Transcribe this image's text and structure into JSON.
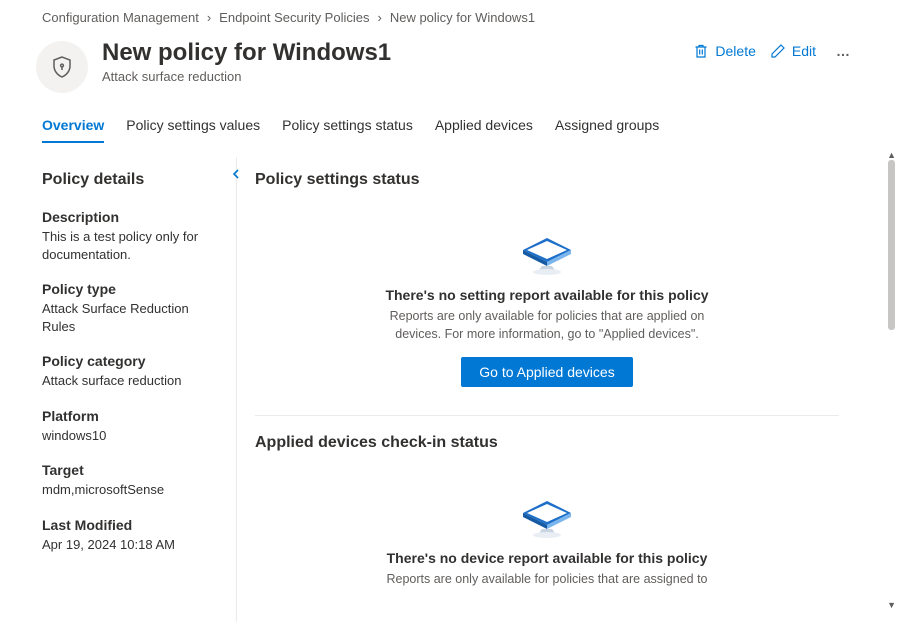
{
  "breadcrumb": {
    "item1": "Configuration Management",
    "item2": "Endpoint Security Policies",
    "item3": "New policy for Windows1"
  },
  "header": {
    "title": "New policy for Windows1",
    "subtitle": "Attack surface reduction",
    "delete_label": "Delete",
    "edit_label": "Edit"
  },
  "tabs": {
    "overview": "Overview",
    "settings_values": "Policy settings values",
    "settings_status": "Policy settings status",
    "applied_devices": "Applied devices",
    "assigned_groups": "Assigned groups"
  },
  "panel": {
    "title": "Policy details",
    "description_label": "Description",
    "description_value": "This is a test policy only for documentation.",
    "type_label": "Policy type",
    "type_value": "Attack Surface Reduction Rules",
    "category_label": "Policy category",
    "category_value": "Attack surface reduction",
    "platform_label": "Platform",
    "platform_value": "windows10",
    "target_label": "Target",
    "target_value": "mdm,microsoftSense",
    "modified_label": "Last Modified",
    "modified_value": "Apr 19, 2024 10:18 AM"
  },
  "main": {
    "section1_title": "Policy settings status",
    "empty1_title": "There's no setting report available for this policy",
    "empty1_desc": "Reports are only available for policies that are applied on devices. For more information, go to \"Applied devices\".",
    "empty1_button": "Go to Applied devices",
    "section2_title": "Applied devices check-in status",
    "empty2_title": "There's no device report available for this policy",
    "empty2_desc": "Reports are only available for policies that are assigned to"
  }
}
